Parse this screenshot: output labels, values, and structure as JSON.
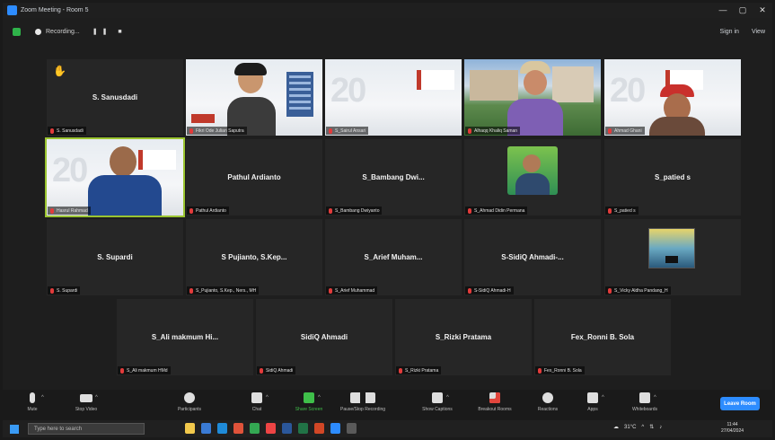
{
  "window": {
    "title": "Zoom Meeting - Room 5",
    "controls": [
      "—",
      "▢",
      "✕"
    ]
  },
  "topstrip": {
    "recording_label": "Recording...",
    "recording_controls": "❚❚ ■",
    "signin": "Sign in",
    "view": "View"
  },
  "tiles": [
    {
      "label": "S. Sanusdadi",
      "bar_name": "S. Sanusdadi",
      "hand": "✋"
    },
    {
      "bar_name": "Fikri Ode Julian Saputra"
    },
    {
      "bar_name": "S_Sairul Ansari"
    },
    {
      "bar_name": "Alhaqq Khaliq Saman"
    },
    {
      "bar_name": "Ahmad Ghani"
    },
    {
      "bar_name": "Hasrul Rahmad"
    },
    {
      "label": "Pathul Ardianto",
      "bar_name": "Pathul Ardianto"
    },
    {
      "label": "S_Bambang Dwi...",
      "bar_name": "S_Bambang Dwiyanto"
    },
    {
      "bar_name": "S_Ahmad Didin Permana"
    },
    {
      "label": "S_patied s",
      "bar_name": "S_patied s"
    },
    {
      "label": "S. Supardi",
      "bar_name": "S. Supardi"
    },
    {
      "label": "S Pujianto, S.Kep...",
      "bar_name": "S_Pujianto, S.Kep., Ners., MH"
    },
    {
      "label": "S_Arief Muham...",
      "bar_name": "S_Arief Muhammad"
    },
    {
      "label": "S-SidiQ Ahmadi-...",
      "bar_name": "S-SidiQ Ahmadi-H"
    },
    {
      "bar_name": "S_Vicky Aldha Pandang_H"
    },
    {
      "label": "S_Ali makmum Hi...",
      "bar_name": "S_Ali makmum HMd"
    },
    {
      "label": "SidiQ Ahmadi",
      "bar_name": "SidiQ Ahmadi"
    },
    {
      "label": "S_Rizki Pratama",
      "bar_name": "S_Rizki Pratama"
    },
    {
      "label": "Fex_Ronni B. Sola",
      "bar_name": "Fex_Ronni B. Sola"
    }
  ],
  "toolbar": {
    "buttons": [
      {
        "label": "Mute"
      },
      {
        "label": "Stop Video"
      },
      {
        "label": "Participants"
      },
      {
        "label": "Chat"
      },
      {
        "label": "Share Screen"
      },
      {
        "label": "Pause/Stop Recording"
      },
      {
        "label": "Show Captions"
      },
      {
        "label": "Breakout Rooms"
      },
      {
        "label": "Reactions"
      },
      {
        "label": "Apps"
      },
      {
        "label": "Whiteboards"
      }
    ],
    "end": "Leave Room"
  },
  "taskbar": {
    "search_placeholder": "Type here to search",
    "weather": "31°C",
    "time": "11:44",
    "date": "27/04/2024"
  }
}
